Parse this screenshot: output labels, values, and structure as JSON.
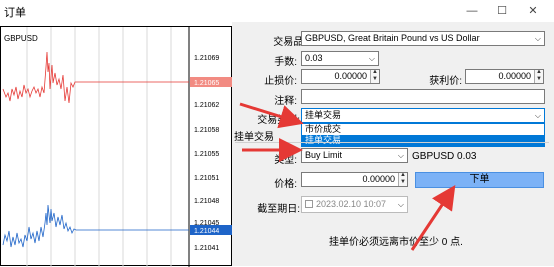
{
  "window": {
    "title": "订单",
    "minimize_icon": "minimize-icon",
    "maximize_icon": "maximize-icon",
    "close_icon": "close-icon"
  },
  "chart": {
    "symbol": "GBPUSD",
    "price_labels": [
      "1.21069",
      "1.21065",
      "1.21062",
      "1.21058",
      "1.21055",
      "1.21051",
      "1.21048",
      "1.21045",
      "1.21044",
      "1.21041"
    ],
    "ask_line_label": "1.21065",
    "bid_line_label": "1.21044",
    "colors": {
      "ask": "#e53935",
      "bid": "#1e88e5",
      "ask_tag": "#f28b82",
      "bid_tag": "#1e64c8"
    }
  },
  "form": {
    "symbol_label": "交易品种:",
    "symbol_value": "GBPUSD, Great Britain Pound vs US Dollar",
    "volume_label": "手数:",
    "volume_value": "0.03",
    "stoploss_label": "止损价:",
    "stoploss_value": "0.00000",
    "takeprofit_label": "获利价:",
    "takeprofit_value": "0.00000",
    "comment_label": "注释:",
    "comment_value": "",
    "type_label": "交易类型:",
    "type_value": "挂单交易",
    "type_options": [
      "市价成交",
      "挂单交易"
    ],
    "type_selected_index": 1,
    "pending_group_label": "挂单交易",
    "pending_type_label": "类型:",
    "pending_type_value": "Buy Limit",
    "pending_symbol_info": "GBPUSD 0.03",
    "price_label": "价格:",
    "price_value": "0.00000",
    "place_button": "下单",
    "expiry_label": "截至期日:",
    "expiry_value": "2023.02.10 10:07",
    "note": "挂单价必须远离市价至少 0 点."
  }
}
